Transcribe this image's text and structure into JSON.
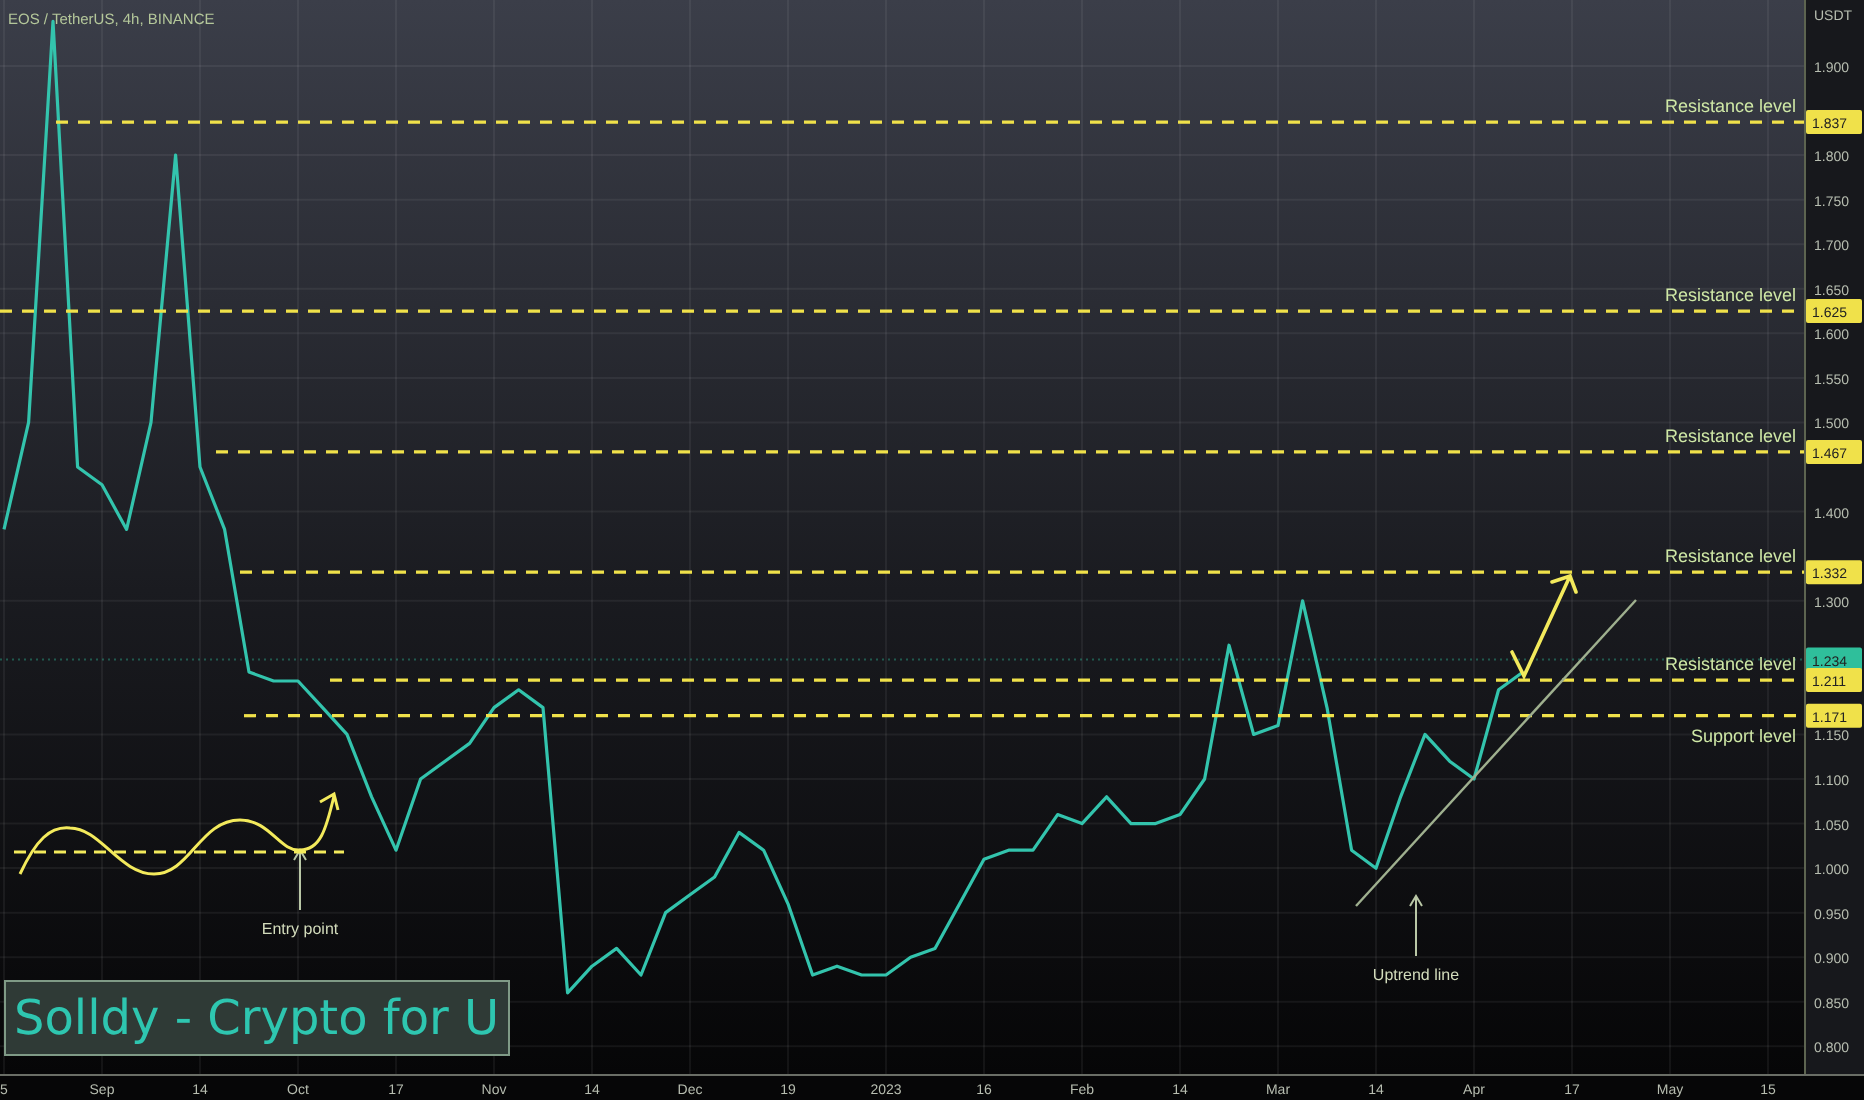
{
  "header": {
    "symbol": "EOS / TetherUS, 4h, BINANCE"
  },
  "brand_banner": {
    "text": "Solldy - Crypto for U"
  },
  "price_tags": [
    {
      "text": "1.837"
    },
    {
      "text": "1.625"
    },
    {
      "text": "1.467"
    },
    {
      "text": "1.332"
    },
    {
      "text": "1.234"
    },
    {
      "text": "1.211"
    },
    {
      "text": "1.171"
    }
  ],
  "notes": [
    {
      "text": "Entry point"
    },
    {
      "text": "Uptrend line"
    }
  ],
  "chart_data": {
    "type": "line",
    "ylabel": "USDT",
    "grid": true,
    "categories": [
      "5",
      null,
      null,
      null,
      "Sep",
      null,
      null,
      null,
      "14",
      null,
      null,
      null,
      "Oct",
      null,
      null,
      null,
      "17",
      null,
      null,
      null,
      "Nov",
      null,
      null,
      null,
      "14",
      null,
      null,
      null,
      "Dec",
      null,
      null,
      null,
      "19",
      null,
      null,
      null,
      "2023",
      null,
      null,
      null,
      "16",
      null,
      null,
      null,
      "Feb",
      null,
      null,
      null,
      "14",
      null,
      null,
      null,
      "Mar",
      null,
      null,
      null,
      "14",
      null,
      null,
      null,
      "Apr",
      null,
      null,
      null,
      "17",
      null,
      null,
      null,
      "May",
      null,
      null,
      null,
      "15",
      null
    ],
    "series": [
      {
        "color": "#33c4ad",
        "values": [
          1.38,
          1.5,
          1.95,
          1.45,
          1.43,
          1.38,
          1.5,
          1.8,
          1.45,
          1.38,
          1.22,
          1.21,
          1.21,
          1.18,
          1.15,
          1.08,
          1.02,
          1.1,
          1.12,
          1.14,
          1.18,
          1.2,
          1.18,
          0.86,
          0.89,
          0.91,
          0.88,
          0.95,
          0.97,
          0.99,
          1.04,
          1.02,
          0.96,
          0.88,
          0.89,
          0.88,
          0.88,
          0.9,
          0.91,
          0.96,
          1.01,
          1.02,
          1.02,
          1.06,
          1.05,
          1.08,
          1.05,
          1.05,
          1.06,
          1.1,
          1.25,
          1.15,
          1.16,
          1.3,
          1.18,
          1.02,
          1.0,
          1.08,
          1.15,
          1.12,
          1.1,
          1.2,
          1.22,
          null,
          null,
          null,
          null,
          null,
          null,
          null,
          null,
          null,
          null,
          null
        ]
      }
    ],
    "ylim": [
      0.769,
      1.974
    ],
    "yticks": [
      {
        "value": 1.9,
        "label": "1.900"
      },
      {
        "value": 1.8,
        "label": "1.800"
      },
      {
        "value": 1.75,
        "label": "1.750"
      },
      {
        "value": 1.7,
        "label": "1.700"
      },
      {
        "value": 1.65,
        "label": "1.650"
      },
      {
        "value": 1.6,
        "label": "1.600"
      },
      {
        "value": 1.55,
        "label": "1.550"
      },
      {
        "value": 1.5,
        "label": "1.500"
      },
      {
        "value": 1.4,
        "label": "1.400"
      },
      {
        "value": 1.3,
        "label": "1.300"
      },
      {
        "value": 1.15,
        "label": "1.150"
      },
      {
        "value": 1.1,
        "label": "1.100"
      },
      {
        "value": 1.05,
        "label": "1.050"
      },
      {
        "value": 1.0,
        "label": "1.000"
      },
      {
        "value": 0.95,
        "label": "0.950"
      },
      {
        "value": 0.9,
        "label": "0.900"
      },
      {
        "value": 0.85,
        "label": "0.850"
      },
      {
        "value": 0.8,
        "label": "0.800"
      }
    ],
    "ref_lines": [
      {
        "axis": "y",
        "value": 1.837,
        "color": "#f0e14a",
        "label": "Resistance level"
      },
      {
        "axis": "y",
        "value": 1.625,
        "color": "#f0e14a",
        "label": "Resistance level"
      },
      {
        "axis": "y",
        "value": 1.467,
        "color": "#f0e14a",
        "label": "Resistance level"
      },
      {
        "axis": "y",
        "value": 1.332,
        "color": "#f0e14a",
        "label": "Resistance level"
      },
      {
        "axis": "y",
        "value": 1.234,
        "color": "#2fbf9b"
      },
      {
        "axis": "y",
        "value": 1.211,
        "color": "#f0e14a",
        "label": "Resistance level"
      },
      {
        "axis": "y",
        "value": 1.171,
        "color": "#f0e14a",
        "label": "Support level"
      }
    ]
  }
}
